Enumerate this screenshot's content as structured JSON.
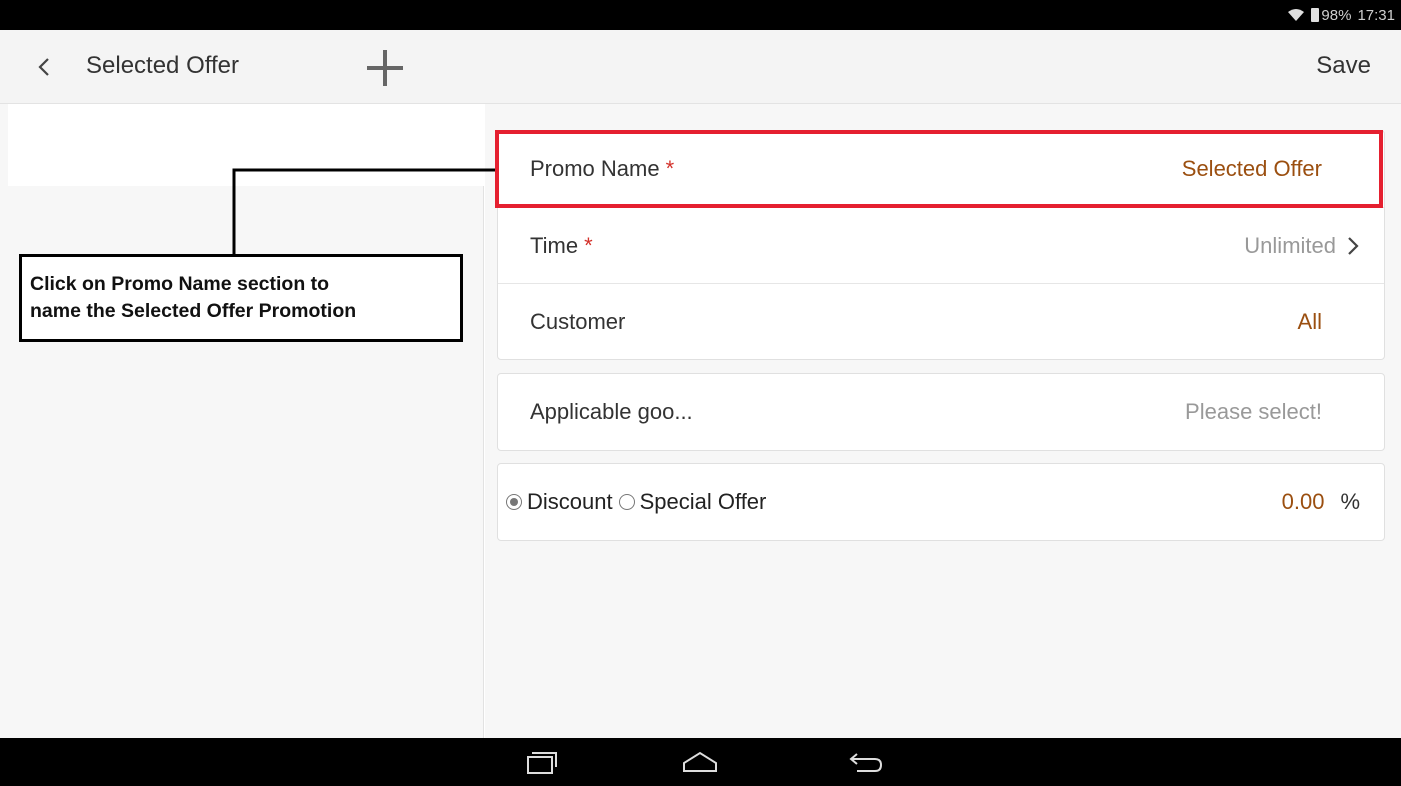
{
  "status": {
    "battery": "98%",
    "time": "17:31"
  },
  "header": {
    "title": "Selected Offer",
    "save_label": "Save"
  },
  "form": {
    "promo_name": {
      "label": "Promo Name",
      "required_mark": "*",
      "value": "Selected Offer"
    },
    "time": {
      "label": "Time",
      "required_mark": "*",
      "value": "Unlimited"
    },
    "customer": {
      "label": "Customer",
      "value": "All"
    },
    "applicable_goods": {
      "label": "Applicable goo...",
      "placeholder": "Please select!"
    },
    "offer_type": {
      "options": [
        "Discount",
        "Special Offer"
      ],
      "selected": "Discount",
      "value": "0.00",
      "unit": "%"
    }
  },
  "annotation": {
    "lines": [
      "Click on Promo Name section to",
      "name the Selected Offer Promotion"
    ]
  },
  "colors": {
    "value_brown": "#9b4f10",
    "required_red": "#d3312a",
    "highlight_red": "#e52030"
  },
  "icons": {
    "back": "chevron-left-icon",
    "add": "plus-icon",
    "wifi": "wifi-icon",
    "battery": "battery-icon",
    "nav_recent": "recent-apps-icon",
    "nav_home": "home-icon",
    "nav_back": "back-arrow-icon"
  }
}
